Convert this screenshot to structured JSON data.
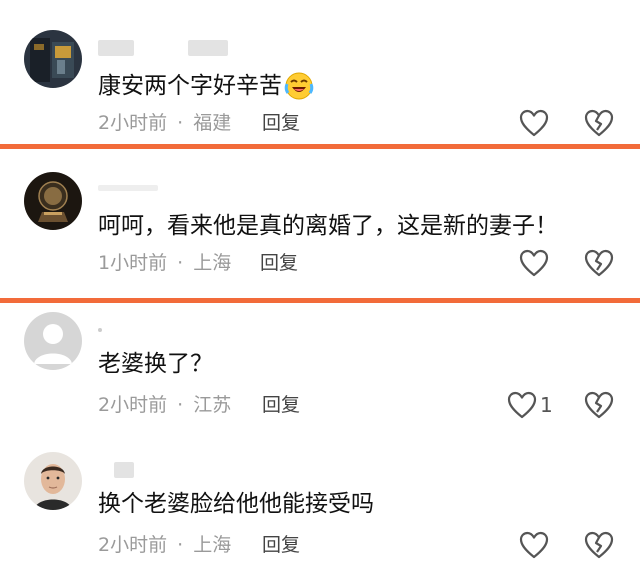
{
  "comments": [
    {
      "text": "康安两个字好辛苦",
      "emoji": "laughing-crying-emoji",
      "time": "2小时前",
      "location": "福建",
      "reply_label": "回复",
      "like_count": ""
    },
    {
      "text": "呵呵，看来他是真的离婚了，这是新的妻子！",
      "time": "1小时前",
      "location": "上海",
      "reply_label": "回复",
      "like_count": ""
    },
    {
      "text": "老婆换了？",
      "time": "2小时前",
      "location": "江苏",
      "reply_label": "回复",
      "like_count": "1"
    },
    {
      "text": "换个老婆脸给他他能接受吗",
      "time": "2小时前",
      "location": "上海",
      "reply_label": "回复",
      "like_count": ""
    }
  ],
  "meta_separator": "·",
  "colors": {
    "divider": "#f26b3a",
    "meta_text": "#9a9a9a",
    "comment_text": "#111111"
  },
  "icons": {
    "like": "heart-outline-icon",
    "dislike": "broken-heart-icon"
  }
}
